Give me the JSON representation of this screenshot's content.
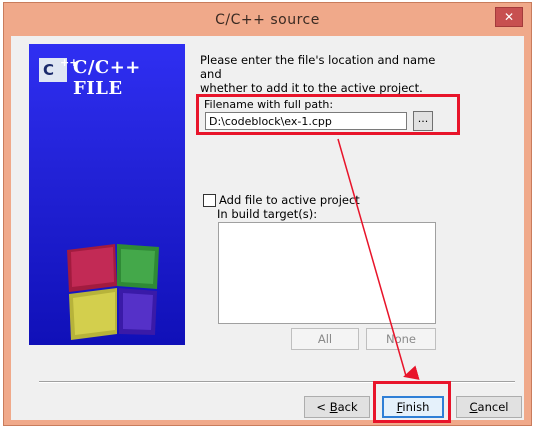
{
  "window": {
    "title": "C/C++ source",
    "close_glyph": "✕"
  },
  "sidebar": {
    "logo_badge": "C",
    "logo_plus": "++",
    "logo_text": "C/C++ FILE",
    "icons": [
      "codeblocks-cube-logo"
    ]
  },
  "intro": {
    "line1": "Please enter the file's location and name and",
    "line2": "whether to add it to the active project."
  },
  "filename": {
    "label": "Filename with full path:",
    "value": "D:\\codeblock\\ex-1.cpp",
    "browse_label": "..."
  },
  "project": {
    "add_label": "Add file to active project",
    "add_checked": false,
    "build_targets_label": "In build target(s):",
    "all_label": "All",
    "none_label": "None"
  },
  "footer": {
    "back_mnemonic": "B",
    "back_rest": "ack",
    "back_prefix": "< ",
    "finish_mnemonic": "F",
    "finish_rest": "inish",
    "cancel_mnemonic": "C",
    "cancel_rest": "ancel"
  },
  "colors": {
    "titlebar": "#f0a98a",
    "sidebar": "#2323d8",
    "highlight": "#e8142a",
    "close": "#c75050"
  }
}
